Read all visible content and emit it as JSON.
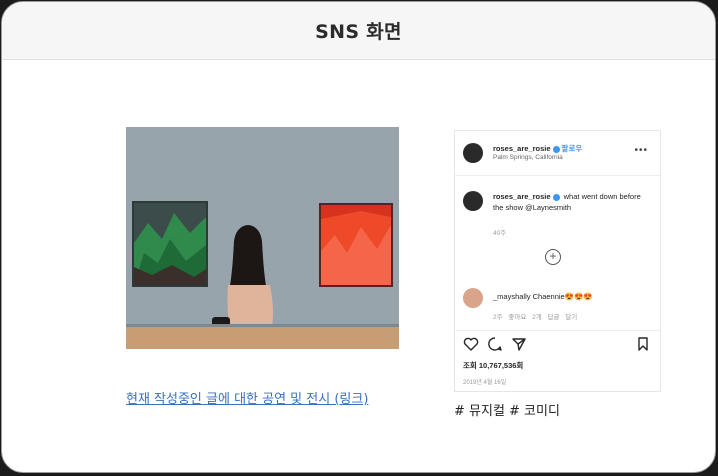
{
  "header": {
    "title": "SNS 화면"
  },
  "link": {
    "text": "현재 작성중인 글에 대한 공연 및 전시 (링크)"
  },
  "instagram": {
    "username": "roses_are_rosie",
    "follow_label": "팔로우",
    "location": "Palm Springs, California",
    "caption_user": "roses_are_rosie",
    "caption_text": "what went down before the show @Laynesmith",
    "caption_time": "40주",
    "comment_user": "_mayshally",
    "comment_text": "Chaennie😍😍😍",
    "comment_meta": "2주   좋아요 2개   답글 달기",
    "views": "조회 10,767,536회",
    "date": "2019년 4월 16일",
    "icons": [
      "heart-icon",
      "comment-icon",
      "share-icon",
      "bookmark-icon",
      "more-icon",
      "add-comment-icon"
    ],
    "colors": {
      "verified": "#3897f0",
      "text": "#262626",
      "muted": "#999999"
    }
  },
  "hashtags": "# 뮤지컬 # 코미디"
}
